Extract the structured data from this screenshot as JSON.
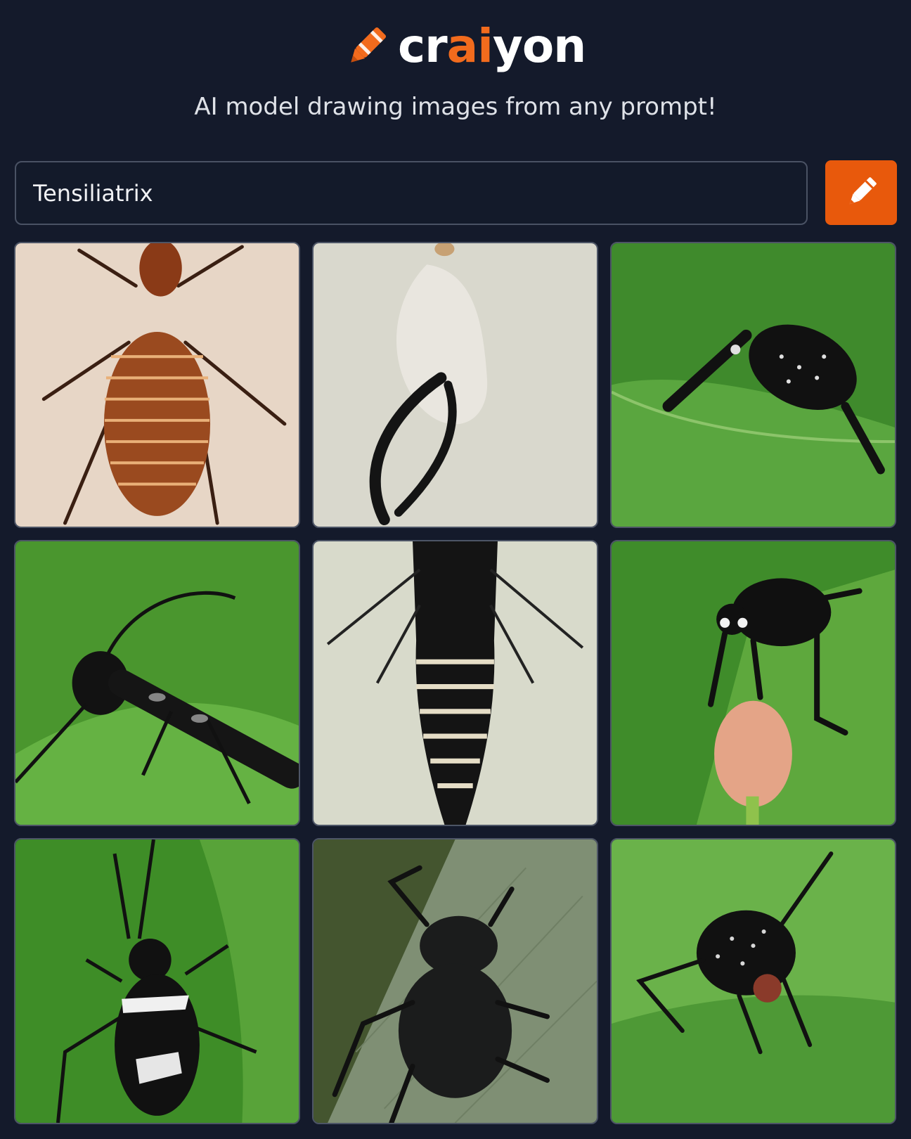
{
  "brand": {
    "name_prefix": "cr",
    "name_accent": "ai",
    "name_suffix": "yon",
    "tagline": "AI model drawing images from any prompt!",
    "accent_color": "#f26b1d"
  },
  "search": {
    "value": "Tensiliatrix",
    "submit_icon": "pencil-icon",
    "button_color": "#e8590c"
  },
  "results": {
    "count": 9,
    "images": [
      {
        "subject": "brown segmented insect on beige background"
      },
      {
        "subject": "white pod with black curled tail on grey background"
      },
      {
        "subject": "black speckled beetle on green leaf"
      },
      {
        "subject": "black glossy insect on green leaf"
      },
      {
        "subject": "black and white striped larva on pale background"
      },
      {
        "subject": "black beetle above pink bud on green leaf"
      },
      {
        "subject": "black and white beetle with long antennae on green leaf"
      },
      {
        "subject": "dark armored beetle on grey-green leaf"
      },
      {
        "subject": "speckled black weevil on green leaf"
      }
    ]
  }
}
